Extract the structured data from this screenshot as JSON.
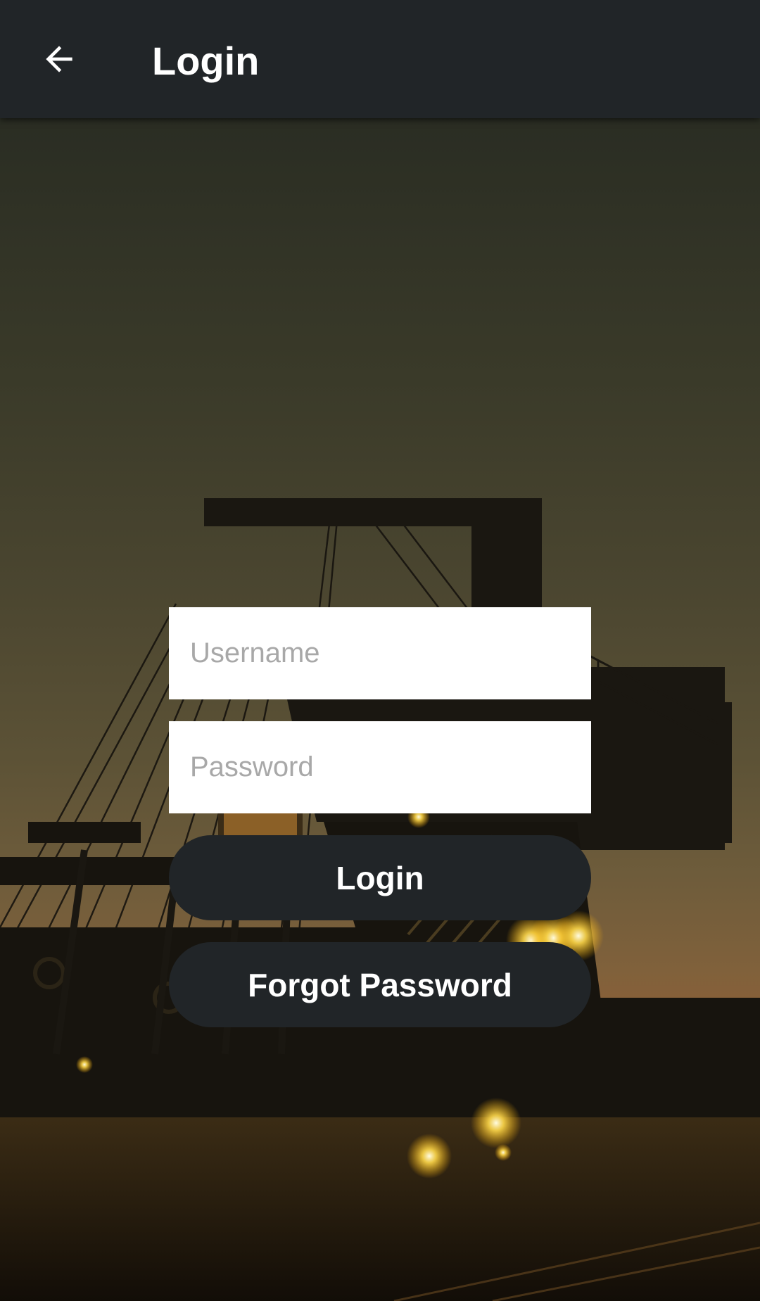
{
  "app_bar": {
    "back_icon": "arrow-back-icon",
    "title": "Login"
  },
  "form": {
    "username_placeholder": "Username",
    "username_value": "",
    "password_placeholder": "Password",
    "password_value": "",
    "login_label": "Login",
    "forgot_label": "Forgot Password"
  },
  "background_image": "bucket-wheel-excavator-at-dusk",
  "colors": {
    "app_bar": "#212528",
    "button": "#212528",
    "button_text": "#ffffff",
    "field": "#ffffff",
    "placeholder": "#a8a8a8"
  }
}
